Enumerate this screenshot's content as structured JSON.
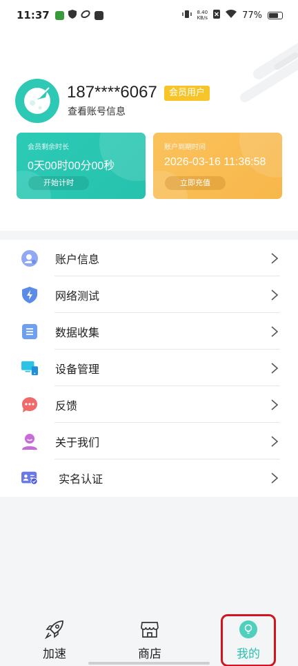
{
  "status_bar": {
    "time": "11:37",
    "net_speed_value": "8.40",
    "net_speed_unit": "KB/s",
    "battery_percent": "77%"
  },
  "profile": {
    "phone": "187****6067",
    "member_badge": "会员用户",
    "view_account_link": "查看账号信息"
  },
  "cards": {
    "remaining": {
      "label": "会员剩余时长",
      "value": "0天00时00分00秒",
      "button": "开始计时"
    },
    "expiry": {
      "label": "账户到期时间",
      "value": "2026-03-16 11:36:58",
      "button": "立即充值"
    }
  },
  "menu": [
    {
      "label": "账户信息",
      "icon": "account-icon"
    },
    {
      "label": "网络测试",
      "icon": "shield-bolt-icon"
    },
    {
      "label": "数据收集",
      "icon": "list-icon"
    },
    {
      "label": "设备管理",
      "icon": "devices-icon"
    },
    {
      "label": "反馈",
      "icon": "chat-bubble-icon"
    },
    {
      "label": "关于我们",
      "icon": "person-icon"
    },
    {
      "label": " 实名认证",
      "icon": "id-card-icon"
    }
  ],
  "tabs": [
    {
      "label": "加速",
      "icon": "rocket-icon"
    },
    {
      "label": "商店",
      "icon": "store-icon"
    },
    {
      "label": "我的",
      "icon": "bulb-icon",
      "active": true
    }
  ],
  "colors": {
    "accent": "#2ac0ad",
    "green_card": "#2bcbb6",
    "yellow_card": "#f7b74a",
    "badge": "#f7c52a",
    "highlight": "#d4141c"
  }
}
